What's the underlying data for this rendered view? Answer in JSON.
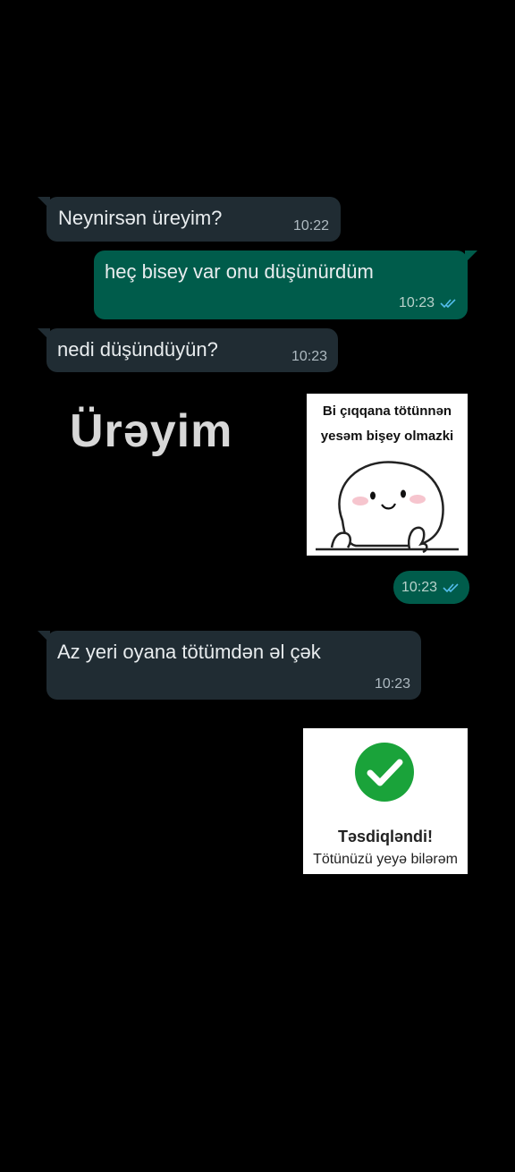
{
  "messages": [
    {
      "text": "Neynirsən üreyim?",
      "time": "10:22"
    },
    {
      "text": "heç bisey var onu düşünürdüm",
      "time": "10:23"
    },
    {
      "text": "nedi düşündüyün?",
      "time": "10:23"
    },
    {
      "text": "",
      "time": "10:23"
    },
    {
      "text": "Az yeri oyana tötümdən əl çək",
      "time": "10:23"
    }
  ],
  "overlay_word": "Ürəyim",
  "sticker": {
    "line1": "Bi çıqqana tötünnən",
    "line2": "yesəm bişey olmazki"
  },
  "confirmation": {
    "title": "Təsdiqləndi!",
    "subtitle": "Tötünüzü yeyə bilərəm",
    "check_color": "#1aa33a"
  },
  "colors": {
    "incoming": "#202c33",
    "outgoing": "#005c4b",
    "read_ticks": "#53bdeb"
  }
}
